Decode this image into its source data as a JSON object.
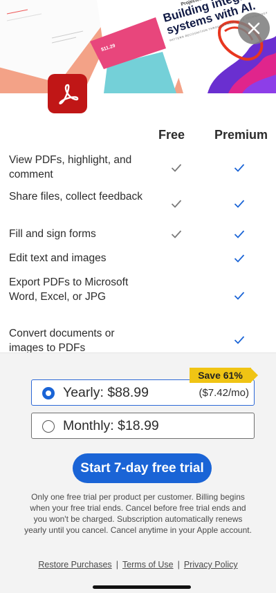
{
  "hero": {
    "small_label": "Projected",
    "headline_lines": [
      "Building integrated",
      "systems with AI."
    ],
    "tagline": "PATTERN RECOGNITION THROUGH PREDICTIVE TECHNOLOGY",
    "price_snippet": "$11.29",
    "close_icon": "close-icon",
    "app_icon": "acrobat-logo-icon",
    "colors": {
      "coral": "#f3a287",
      "teal": "#74d0d8",
      "purple": "#6a2fd0",
      "pink": "#e0258c",
      "acrobat_red": "#c01616"
    }
  },
  "comparison": {
    "columns": {
      "free": "Free",
      "premium": "Premium"
    },
    "features": [
      {
        "label": "View PDFs, highlight, and comment",
        "free": true,
        "premium": true
      },
      {
        "label": "Share files, collect feedback",
        "free": true,
        "premium": true
      },
      {
        "label": "Fill and sign forms",
        "free": true,
        "premium": true
      },
      {
        "label": "Edit text and images",
        "free": false,
        "premium": true
      },
      {
        "label": "Export PDFs to Microsoft Word, Excel, or JPG",
        "free": false,
        "premium": true
      },
      {
        "label": "Convert documents or images to PDFs",
        "free": false,
        "premium": true
      }
    ],
    "check_colors": {
      "free": "#7a7a7a",
      "premium": "#1a64d6"
    }
  },
  "plans": {
    "save_badge": "Save 61%",
    "yearly": {
      "label": "Yearly: $88.99",
      "sub": "($7.42/mo)",
      "selected": true
    },
    "monthly": {
      "label": "Monthly: $18.99",
      "selected": false
    }
  },
  "cta": {
    "label": "Start 7-day free trial",
    "color": "#1a64d6"
  },
  "fine_print": "Only one free trial per product per customer. Billing begins when your free trial ends. Cancel before free trial ends and you won't be charged. Subscription automatically renews yearly until you cancel. Cancel anytime in your Apple account.",
  "footer_links": {
    "restore": "Restore Purchases",
    "separator": "|",
    "terms": "Terms of Use",
    "privacy": "Privacy Policy"
  }
}
